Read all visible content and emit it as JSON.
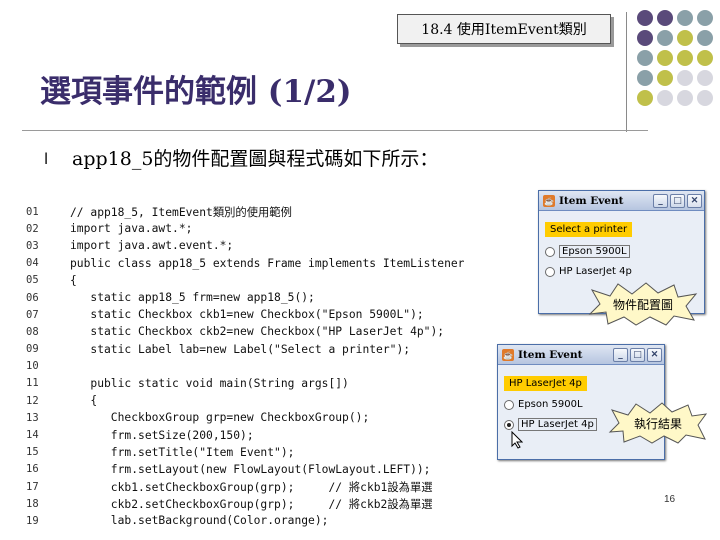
{
  "header": {
    "section_tag": "18.4 使用ItemEvent類別"
  },
  "decor": {
    "dot_colors": [
      "#5a4a7a",
      "#5a4a7a",
      "#8aa0a8",
      "#8aa0a8",
      "#5a4a7a",
      "#8aa0a8",
      "#c0c04a",
      "#8aa0a8",
      "#8aa0a8",
      "#c0c04a",
      "#c0c04a",
      "#c0c04a",
      "#8aa0a8",
      "#c0c04a",
      "#d7d7df",
      "#d7d7df",
      "#c0c04a",
      "#d7d7df",
      "#d7d7df",
      "#d7d7df"
    ]
  },
  "slide": {
    "title": "選項事件的範例 (1/2)",
    "bullet_glyph": "l",
    "bullet_text": "app18_5的物件配置圖與程式碼如下所示："
  },
  "code": {
    "lines": [
      {
        "num": "01",
        "text": "// app18_5, ItemEvent類別的使用範例"
      },
      {
        "num": "02",
        "text": "import java.awt.*;"
      },
      {
        "num": "03",
        "text": "import java.awt.event.*;"
      },
      {
        "num": "04",
        "text": "public class app18_5 extends Frame implements ItemListener"
      },
      {
        "num": "05",
        "text": "{"
      },
      {
        "num": "06",
        "text": "   static app18_5 frm=new app18_5();"
      },
      {
        "num": "07",
        "text": "   static Checkbox ckb1=new Checkbox(\"Epson 5900L\");"
      },
      {
        "num": "08",
        "text": "   static Checkbox ckb2=new Checkbox(\"HP LaserJet 4p\");"
      },
      {
        "num": "09",
        "text": "   static Label lab=new Label(\"Select a printer\");"
      },
      {
        "num": "10",
        "text": ""
      },
      {
        "num": "11",
        "text": "   public static void main(String args[])"
      },
      {
        "num": "12",
        "text": "   {"
      },
      {
        "num": "13",
        "text": "      CheckboxGroup grp=new CheckboxGroup();"
      },
      {
        "num": "14",
        "text": "      frm.setSize(200,150);"
      },
      {
        "num": "15",
        "text": "      frm.setTitle(\"Item Event\");"
      },
      {
        "num": "16",
        "text": "      frm.setLayout(new FlowLayout(FlowLayout.LEFT));"
      },
      {
        "num": "17",
        "text": "      ckb1.setCheckboxGroup(grp);     // 將ckb1設為單選"
      },
      {
        "num": "18",
        "text": "      ckb2.setCheckboxGroup(grp);     // 將ckb2設為單選"
      },
      {
        "num": "19",
        "text": "      lab.setBackground(Color.orange);"
      }
    ]
  },
  "window1": {
    "title": "Item Event",
    "label": "Select a printer",
    "options": [
      {
        "text": "Epson 5900L",
        "checked": false,
        "boxed": true
      },
      {
        "text": "HP LaserJet 4p",
        "checked": false,
        "boxed": false
      }
    ],
    "callout": "物件配置圖"
  },
  "window2": {
    "title": "Item Event",
    "label": "HP LaserJet 4p",
    "options": [
      {
        "text": "Epson 5900L",
        "checked": false,
        "boxed": false
      },
      {
        "text": "HP LaserJet 4p",
        "checked": true,
        "boxed": true
      }
    ],
    "callout": "執行結果"
  },
  "footer": {
    "page_number": "16"
  }
}
